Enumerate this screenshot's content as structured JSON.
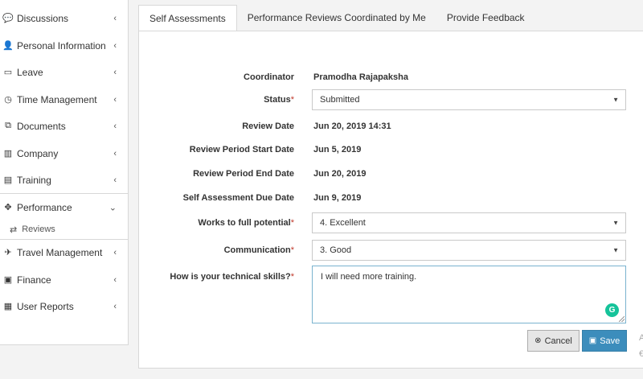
{
  "sidebar": {
    "items": [
      {
        "label": "Discussions",
        "icon": "chat-icon",
        "glyph": "💬"
      },
      {
        "label": "Personal Information",
        "icon": "person-icon",
        "glyph": "👤"
      },
      {
        "label": "Leave",
        "icon": "calendar-icon",
        "glyph": "▭"
      },
      {
        "label": "Time Management",
        "icon": "clock-icon",
        "glyph": "◷"
      },
      {
        "label": "Documents",
        "icon": "documents-icon",
        "glyph": "⧉"
      },
      {
        "label": "Company",
        "icon": "building-icon",
        "glyph": "▥"
      },
      {
        "label": "Training",
        "icon": "briefcase-icon",
        "glyph": "▤"
      },
      {
        "label": "Performance",
        "icon": "arrows-icon",
        "glyph": "✥"
      },
      {
        "label": "Reviews",
        "icon": "exchange-icon",
        "glyph": "⇄"
      },
      {
        "label": "Travel Management",
        "icon": "plane-icon",
        "glyph": "✈"
      },
      {
        "label": "Finance",
        "icon": "money-icon",
        "glyph": "▣"
      },
      {
        "label": "User Reports",
        "icon": "file-icon",
        "glyph": "▦"
      }
    ],
    "chevron_collapsed": "‹",
    "chevron_expanded": "⌄"
  },
  "tabs": [
    {
      "label": "Self Assessments"
    },
    {
      "label": "Performance Reviews Coordinated by Me"
    },
    {
      "label": "Provide Feedback"
    }
  ],
  "form": {
    "coordinator_label": "Coordinator",
    "coordinator_value": "Pramodha Rajapaksha",
    "status_label": "Status",
    "status_value": "Submitted",
    "review_date_label": "Review Date",
    "review_date_value": "Jun 20, 2019 14:31",
    "period_start_label": "Review Period Start Date",
    "period_start_value": "Jun 5, 2019",
    "period_end_label": "Review Period End Date",
    "period_end_value": "Jun 20, 2019",
    "due_date_label": "Self Assessment Due Date",
    "due_date_value": "Jun 9, 2019",
    "potential_label": "Works to full potential",
    "potential_value": "4. Excellent",
    "communication_label": "Communication",
    "communication_value": "3. Good",
    "technical_label": "How is your technical skills?",
    "technical_value": "I will need more training.",
    "required_mark": "*"
  },
  "buttons": {
    "cancel_label": "Cancel",
    "save_label": "Save",
    "cancel_glyph": "⊗",
    "save_glyph": "▣"
  },
  "edge_chars": [
    "A",
    "€"
  ],
  "colors": {
    "primary": "#3c8dbc",
    "required": "#c0392b",
    "grammarly": "#15c39a"
  }
}
